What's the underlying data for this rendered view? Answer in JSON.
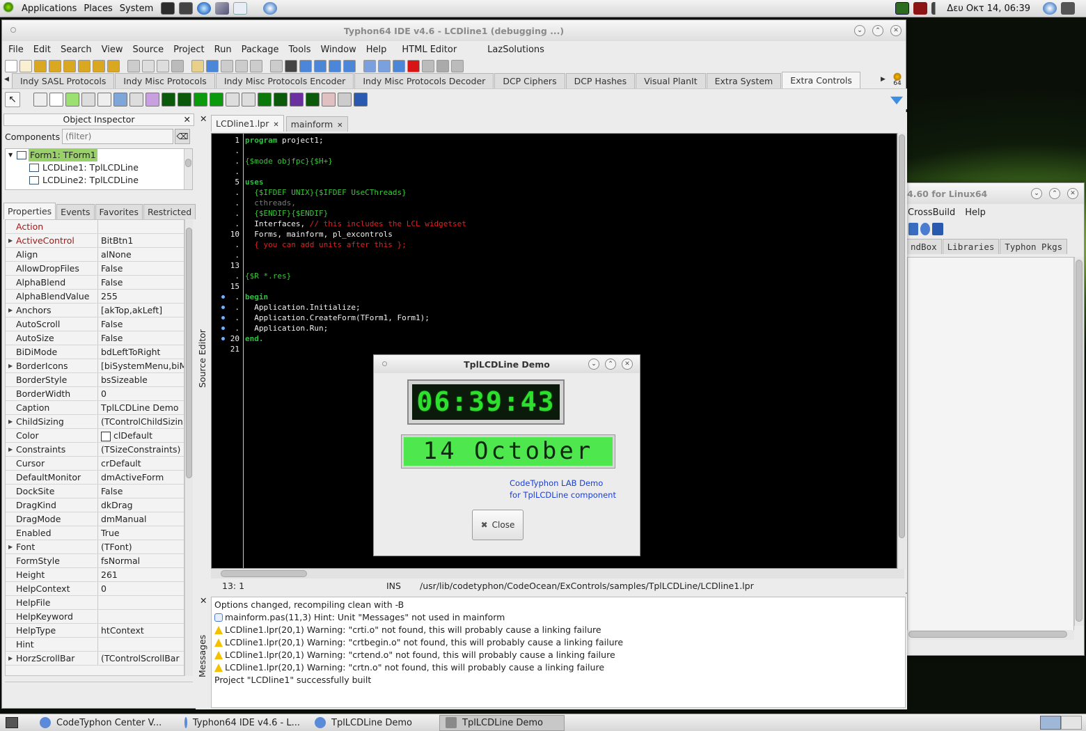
{
  "top_panel": {
    "menus": [
      "Applications",
      "Places",
      "System"
    ],
    "clock": "Δευ Οκτ 14, 06:39"
  },
  "ide": {
    "title": "Typhon64 IDE v4.6 - LCDline1 (debugging ...)",
    "menu": [
      "File",
      "Edit",
      "Search",
      "View",
      "Source",
      "Project",
      "Run",
      "Package",
      "Tools",
      "Window",
      "Help",
      "HTML Editor",
      "LazSolutions"
    ],
    "palette_tabs": [
      "Indy SASL Protocols",
      "Indy Misc Protocols",
      "Indy Misc Protocols Encoder",
      "Indy Misc Protocols Decoder",
      "DCP Ciphers",
      "DCP Hashes",
      "Visual PlanIt",
      "Extra System",
      "Extra Controls"
    ],
    "active_palette_tab": "Extra Controls",
    "bitness_badge": "64",
    "component_icons": [
      "ex-icon",
      "clock-icon",
      "shape-icon",
      "edit-icon",
      "list-icon",
      "image-icon",
      "grid-icon",
      "gradient-icon",
      "gauge-icon",
      "abc-icon",
      "lcd-icon",
      "gear-icon",
      "tree-icon",
      "network-icon",
      "led-icon",
      "scope-icon",
      "disc-icon",
      "chart-icon",
      "badge-icon",
      "table-icon",
      "globe-icon"
    ]
  },
  "object_inspector": {
    "title": "Object Inspector",
    "components_label": "Components",
    "filter_placeholder": "(filter)",
    "tree": [
      "Form1: TForm1",
      "LCDLine1: TplLCDLine",
      "LCDLine2: TplLCDLine"
    ],
    "tabs": [
      "Properties",
      "Events",
      "Favorites",
      "Restricted"
    ],
    "properties": [
      {
        "name": "Action",
        "value": "",
        "red": true,
        "expand": false
      },
      {
        "name": "ActiveControl",
        "value": "BitBtn1",
        "red": true,
        "expand": true
      },
      {
        "name": "Align",
        "value": "alNone",
        "red": false,
        "expand": false
      },
      {
        "name": "AllowDropFiles",
        "value": "False",
        "red": false,
        "expand": false
      },
      {
        "name": "AlphaBlend",
        "value": "False",
        "red": false,
        "expand": false
      },
      {
        "name": "AlphaBlendValue",
        "value": "255",
        "red": false,
        "expand": false
      },
      {
        "name": "Anchors",
        "value": "[akTop,akLeft]",
        "red": false,
        "expand": true
      },
      {
        "name": "AutoScroll",
        "value": "False",
        "red": false,
        "expand": false
      },
      {
        "name": "AutoSize",
        "value": "False",
        "red": false,
        "expand": false
      },
      {
        "name": "BiDiMode",
        "value": "bdLeftToRight",
        "red": false,
        "expand": false
      },
      {
        "name": "BorderIcons",
        "value": "[biSystemMenu,biM",
        "red": false,
        "expand": true
      },
      {
        "name": "BorderStyle",
        "value": "bsSizeable",
        "red": false,
        "expand": false
      },
      {
        "name": "BorderWidth",
        "value": "0",
        "red": false,
        "expand": false
      },
      {
        "name": "Caption",
        "value": "TplLCDLine Demo",
        "red": false,
        "expand": false
      },
      {
        "name": "ChildSizing",
        "value": "(TControlChildSizin",
        "red": false,
        "expand": true
      },
      {
        "name": "Color",
        "value": "clDefault",
        "red": false,
        "expand": false,
        "swatch": true
      },
      {
        "name": "Constraints",
        "value": "(TSizeConstraints)",
        "red": false,
        "expand": true
      },
      {
        "name": "Cursor",
        "value": "crDefault",
        "red": false,
        "expand": false
      },
      {
        "name": "DefaultMonitor",
        "value": "dmActiveForm",
        "red": false,
        "expand": false
      },
      {
        "name": "DockSite",
        "value": "False",
        "red": false,
        "expand": false
      },
      {
        "name": "DragKind",
        "value": "dkDrag",
        "red": false,
        "expand": false
      },
      {
        "name": "DragMode",
        "value": "dmManual",
        "red": false,
        "expand": false
      },
      {
        "name": "Enabled",
        "value": "True",
        "red": false,
        "expand": false
      },
      {
        "name": "Font",
        "value": "(TFont)",
        "red": false,
        "expand": true
      },
      {
        "name": "FormStyle",
        "value": "fsNormal",
        "red": false,
        "expand": false
      },
      {
        "name": "Height",
        "value": "261",
        "red": false,
        "expand": false
      },
      {
        "name": "HelpContext",
        "value": "0",
        "red": false,
        "expand": false
      },
      {
        "name": "HelpFile",
        "value": "",
        "red": false,
        "expand": false
      },
      {
        "name": "HelpKeyword",
        "value": "",
        "red": false,
        "expand": false
      },
      {
        "name": "HelpType",
        "value": "htContext",
        "red": false,
        "expand": false
      },
      {
        "name": "Hint",
        "value": "",
        "red": false,
        "expand": false
      },
      {
        "name": "HorzScrollBar",
        "value": "(TControlScrollBar",
        "red": false,
        "expand": true
      }
    ]
  },
  "source_editor": {
    "side_label": "Source Editor",
    "tabs": [
      "LCDline1.lpr",
      "mainform"
    ],
    "active_tab": "LCDline1.lpr",
    "gutter": [
      {
        "n": "1",
        "bp": false
      },
      {
        "n": ".",
        "bp": false
      },
      {
        "n": ".",
        "bp": false
      },
      {
        "n": ".",
        "bp": false
      },
      {
        "n": "5",
        "bp": false
      },
      {
        "n": ".",
        "bp": false
      },
      {
        "n": ".",
        "bp": false
      },
      {
        "n": ".",
        "bp": false
      },
      {
        "n": ".",
        "bp": false
      },
      {
        "n": "10",
        "bp": false
      },
      {
        "n": ".",
        "bp": false
      },
      {
        "n": ".",
        "bp": false
      },
      {
        "n": "13",
        "bp": false
      },
      {
        "n": ".",
        "bp": false
      },
      {
        "n": "15",
        "bp": false
      },
      {
        "n": ".",
        "bp": true
      },
      {
        "n": ".",
        "bp": true
      },
      {
        "n": ".",
        "bp": true
      },
      {
        "n": ".",
        "bp": true
      },
      {
        "n": "20",
        "bp": true
      },
      {
        "n": "21",
        "bp": false
      }
    ],
    "lines": [
      [
        {
          "t": "program",
          "c": "#2ec040",
          "b": true
        },
        {
          "t": " project1;",
          "c": "#f2f2f2"
        }
      ],
      [],
      [
        {
          "t": "{$mode objfpc}{$H+}",
          "c": "#39c739"
        }
      ],
      [],
      [
        {
          "t": "uses",
          "c": "#2ec040",
          "b": true
        }
      ],
      [
        {
          "t": "  {$IFDEF UNIX}{$IFDEF UseCThreads}",
          "c": "#39c739"
        }
      ],
      [
        {
          "t": "  cthreads,",
          "c": "#7a7a7a"
        }
      ],
      [
        {
          "t": "  {$ENDIF}{$ENDIF}",
          "c": "#39c739"
        }
      ],
      [
        {
          "t": "  Interfaces, ",
          "c": "#f2f2f2"
        },
        {
          "t": "// this includes the LCL widgetset",
          "c": "#e02020"
        }
      ],
      [
        {
          "t": "  Forms, mainform, pl_excontrols",
          "c": "#f2f2f2"
        }
      ],
      [
        {
          "t": "  { you can add units after this };",
          "c": "#e02020"
        }
      ],
      [],
      [],
      [
        {
          "t": "{$R *.res}",
          "c": "#39c739"
        }
      ],
      [],
      [
        {
          "t": "begin",
          "c": "#2ec040",
          "b": true
        }
      ],
      [
        {
          "t": "  Application.Initialize;",
          "c": "#f2f2f2"
        }
      ],
      [
        {
          "t": "  Application.CreateForm(TForm1, Form1);",
          "c": "#f2f2f2"
        }
      ],
      [
        {
          "t": "  Application.Run;",
          "c": "#f2f2f2"
        }
      ],
      [
        {
          "t": "end.",
          "c": "#2ec040",
          "b": true
        }
      ],
      []
    ],
    "status": {
      "pos": "13:  1",
      "mode": "INS",
      "path": "/usr/lib/codetyphon/CodeOcean/ExControls/samples/TplLCDLine/LCDline1.lpr"
    }
  },
  "messages": {
    "side_label": "Messages",
    "items": [
      {
        "icon": "none",
        "text": "Options changed, recompiling clean with -B"
      },
      {
        "icon": "hint",
        "text": "mainform.pas(11,3) Hint: Unit \"Messages\" not used in mainform"
      },
      {
        "icon": "warning",
        "text": "LCDline1.lpr(20,1) Warning: \"crti.o\" not found, this will probably cause a linking failure"
      },
      {
        "icon": "warning",
        "text": "LCDline1.lpr(20,1) Warning: \"crtbegin.o\" not found, this will probably cause a linking failure"
      },
      {
        "icon": "warning",
        "text": "LCDline1.lpr(20,1) Warning: \"crtend.o\" not found, this will probably cause a linking failure"
      },
      {
        "icon": "warning",
        "text": "LCDline1.lpr(20,1) Warning: \"crtn.o\" not found, this will probably cause a linking failure"
      },
      {
        "icon": "none",
        "text": "Project \"LCDline1\" successfully built"
      }
    ]
  },
  "demo": {
    "title": "TplLCDLine Demo",
    "lcd_time": "06:39:43",
    "lcd_date": "14 October",
    "info_line1": "CodeTyphon LAB Demo",
    "info_line2": "for TplLCDLine component",
    "close_label": "Close"
  },
  "back_window": {
    "title": "4.60 for Linux64",
    "menu": [
      "CrossBuild",
      "Help"
    ],
    "tabs": [
      "ndBox",
      "Libraries",
      "Typhon Pkgs"
    ]
  },
  "taskbar": {
    "tasks": [
      "CodeTyphon Center V...",
      "Typhon64 IDE v4.6 - L...",
      "TplLCDLine Demo",
      "TplLCDLine Demo"
    ],
    "active_task": 3
  },
  "colors": {
    "lcd_green": "#2ee02e",
    "lcd_bg_dark": "#0b1a0b",
    "lcd_bg_light": "#4ee84e",
    "code_bg": "#000000",
    "link_blue": "#1a3fd6"
  }
}
